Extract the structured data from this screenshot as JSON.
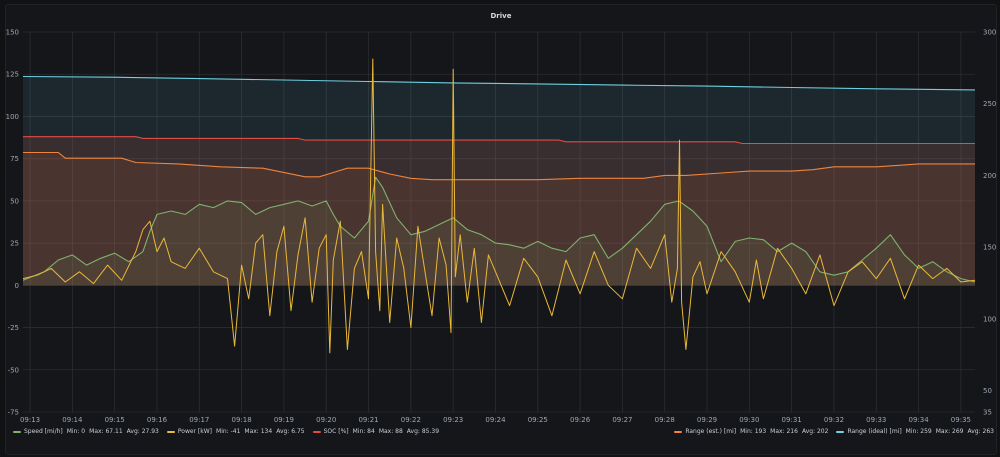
{
  "panel": {
    "title": "Drive"
  },
  "chart_data": {
    "type": "line",
    "title": "Drive",
    "x_ticks": [
      "09:13",
      "09:14",
      "09:15",
      "09:16",
      "09:17",
      "09:18",
      "09:19",
      "09:20",
      "09:21",
      "09:22",
      "09:23",
      "09:24",
      "09:25",
      "09:26",
      "09:27",
      "09:28",
      "09:29",
      "09:30",
      "09:31",
      "09:32",
      "09:33",
      "09:34",
      "09:35"
    ],
    "x_range": [
      "09:12:50",
      "09:35:20"
    ],
    "y_left": {
      "range": [
        -75,
        150
      ],
      "ticks": [
        "150",
        "125",
        "100",
        "75",
        "50",
        "25",
        "0",
        "-25",
        "-50",
        "-75"
      ]
    },
    "y_right": {
      "range": [
        35,
        300
      ],
      "ticks": [
        "300",
        "250",
        "200",
        "150",
        "100",
        "50",
        "35"
      ]
    },
    "grid": true,
    "legend_position": "bottom",
    "series": [
      {
        "name": "Speed [mi/h]",
        "axis": "left",
        "color": "#7eb26d",
        "fill": true,
        "stats": {
          "min": "Min: 0",
          "max": "Max: 67.11",
          "avg": "Avg: 27.93"
        },
        "x": [
          "09:12:50",
          "09:13:20",
          "09:13:40",
          "09:14:00",
          "09:14:20",
          "09:14:40",
          "09:15:00",
          "09:15:20",
          "09:15:40",
          "09:15:50",
          "09:16:00",
          "09:16:20",
          "09:16:40",
          "09:17:00",
          "09:17:20",
          "09:17:40",
          "09:18:00",
          "09:18:20",
          "09:18:40",
          "09:19:00",
          "09:19:20",
          "09:19:40",
          "09:20:00",
          "09:20:10",
          "09:20:20",
          "09:20:40",
          "09:21:00",
          "09:21:10",
          "09:21:20",
          "09:21:40",
          "09:22:00",
          "09:22:20",
          "09:22:40",
          "09:23:00",
          "09:23:20",
          "09:23:40",
          "09:24:00",
          "09:24:20",
          "09:24:40",
          "09:25:00",
          "09:25:20",
          "09:25:40",
          "09:26:00",
          "09:26:20",
          "09:26:40",
          "09:27:00",
          "09:27:20",
          "09:27:40",
          "09:28:00",
          "09:28:20",
          "09:28:40",
          "09:29:00",
          "09:29:20",
          "09:29:40",
          "09:30:00",
          "09:30:20",
          "09:30:40",
          "09:31:00",
          "09:31:20",
          "09:31:40",
          "09:32:00",
          "09:32:20",
          "09:32:40",
          "09:33:00",
          "09:33:20",
          "09:33:40",
          "09:34:00",
          "09:34:20",
          "09:34:40",
          "09:35:00",
          "09:35:20"
        ],
        "y": [
          3,
          8,
          15,
          18,
          12,
          16,
          19,
          14,
          20,
          32,
          42,
          44,
          42,
          48,
          46,
          50,
          49,
          42,
          46,
          48,
          50,
          47,
          50,
          42,
          35,
          28,
          38,
          64,
          58,
          40,
          30,
          32,
          36,
          40,
          33,
          30,
          25,
          24,
          22,
          26,
          22,
          20,
          28,
          30,
          16,
          22,
          30,
          38,
          48,
          50,
          44,
          35,
          14,
          26,
          28,
          27,
          20,
          25,
          20,
          8,
          6,
          8,
          15,
          22,
          30,
          18,
          10,
          14,
          8,
          4,
          2
        ]
      },
      {
        "name": "Power [kW]",
        "axis": "left",
        "color": "#eab839",
        "fill": false,
        "stats": {
          "min": "Min: -41",
          "max": "Max: 134",
          "avg": "Avg: 6.75"
        },
        "x": [
          "09:12:50",
          "09:13:10",
          "09:13:30",
          "09:13:50",
          "09:14:10",
          "09:14:30",
          "09:14:50",
          "09:15:10",
          "09:15:30",
          "09:15:40",
          "09:15:50",
          "09:16:00",
          "09:16:10",
          "09:16:20",
          "09:16:40",
          "09:17:00",
          "09:17:20",
          "09:17:40",
          "09:17:50",
          "09:18:00",
          "09:18:10",
          "09:18:20",
          "09:18:30",
          "09:18:40",
          "09:18:50",
          "09:19:00",
          "09:19:10",
          "09:19:20",
          "09:19:30",
          "09:19:40",
          "09:19:50",
          "09:20:00",
          "09:20:05",
          "09:20:10",
          "09:20:20",
          "09:20:30",
          "09:20:40",
          "09:20:50",
          "09:21:00",
          "09:21:06",
          "09:21:10",
          "09:21:16",
          "09:21:20",
          "09:21:30",
          "09:21:40",
          "09:21:50",
          "09:22:00",
          "09:22:10",
          "09:22:20",
          "09:22:30",
          "09:22:40",
          "09:22:50",
          "09:22:57",
          "09:23:00",
          "09:23:03",
          "09:23:10",
          "09:23:20",
          "09:23:30",
          "09:23:40",
          "09:23:50",
          "09:24:00",
          "09:24:20",
          "09:24:40",
          "09:25:00",
          "09:25:20",
          "09:25:40",
          "09:26:00",
          "09:26:20",
          "09:26:40",
          "09:27:00",
          "09:27:20",
          "09:27:40",
          "09:28:00",
          "09:28:10",
          "09:28:18",
          "09:28:21",
          "09:28:24",
          "09:28:30",
          "09:28:40",
          "09:28:50",
          "09:29:00",
          "09:29:20",
          "09:29:40",
          "09:30:00",
          "09:30:10",
          "09:30:20",
          "09:30:40",
          "09:31:00",
          "09:31:20",
          "09:31:40",
          "09:32:00",
          "09:32:20",
          "09:32:40",
          "09:33:00",
          "09:33:20",
          "09:33:40",
          "09:34:00",
          "09:34:20",
          "09:34:40",
          "09:35:00",
          "09:35:20"
        ],
        "y": [
          4,
          6,
          10,
          2,
          8,
          1,
          12,
          3,
          20,
          33,
          38,
          20,
          28,
          14,
          10,
          22,
          8,
          4,
          -36,
          12,
          -8,
          25,
          30,
          -18,
          20,
          35,
          -15,
          18,
          40,
          -10,
          22,
          30,
          -40,
          15,
          38,
          -38,
          10,
          20,
          -8,
          134,
          20,
          -15,
          48,
          -22,
          28,
          10,
          -25,
          35,
          8,
          -18,
          28,
          12,
          -28,
          128,
          5,
          30,
          -10,
          22,
          -22,
          18,
          8,
          -12,
          16,
          5,
          -18,
          15,
          -5,
          20,
          0,
          -8,
          22,
          10,
          30,
          -10,
          10,
          86,
          -10,
          -38,
          5,
          14,
          -5,
          20,
          8,
          -10,
          15,
          -8,
          22,
          10,
          -5,
          18,
          -12,
          8,
          14,
          4,
          16,
          -8,
          12,
          4,
          10,
          2,
          3
        ]
      },
      {
        "name": "SOC [%]",
        "axis": "left",
        "color": "#e24d42",
        "fill": true,
        "stats": {
          "min": "Min: 84",
          "max": "Max: 88",
          "avg": "Avg: 85.39"
        },
        "x": [
          "09:12:50",
          "09:15:30",
          "09:15:40",
          "09:19:20",
          "09:19:30",
          "09:25:30",
          "09:25:40",
          "09:29:40",
          "09:29:50",
          "09:35:20"
        ],
        "y": [
          88,
          88,
          87,
          87,
          86,
          86,
          85,
          85,
          84,
          84
        ]
      },
      {
        "name": "Range (est.) [mi]",
        "axis": "right",
        "color": "#ef843c",
        "fill": true,
        "stats": {
          "min": "Min: 193",
          "max": "Max: 216",
          "avg": "Avg: 202"
        },
        "x": [
          "09:12:50",
          "09:13:40",
          "09:13:50",
          "09:15:10",
          "09:15:30",
          "09:16:30",
          "09:17:30",
          "09:18:30",
          "09:19:30",
          "09:19:50",
          "09:20:10",
          "09:20:30",
          "09:21:00",
          "09:21:30",
          "09:22:00",
          "09:22:30",
          "09:23:30",
          "09:24:30",
          "09:25:00",
          "09:26:00",
          "09:26:30",
          "09:27:30",
          "09:28:00",
          "09:28:30",
          "09:29:30",
          "09:30:00",
          "09:31:00",
          "09:31:30",
          "09:32:00",
          "09:33:00",
          "09:33:30",
          "09:34:00",
          "09:35:20"
        ],
        "y": [
          216,
          216,
          212,
          212,
          209,
          208,
          206,
          205,
          199,
          199,
          202,
          205,
          205,
          201,
          198,
          197,
          197,
          197,
          197,
          198,
          198,
          198,
          200,
          200,
          202,
          203,
          203,
          204,
          206,
          206,
          207,
          208,
          208
        ]
      },
      {
        "name": "Range (ideal) [mi]",
        "axis": "right",
        "color": "#6ed0e0",
        "fill": true,
        "stats": {
          "min": "Min: 259",
          "max": "Max: 269",
          "avg": "Avg: 263"
        },
        "x": [
          "09:12:50",
          "09:15:00",
          "09:17:00",
          "09:19:00",
          "09:21:00",
          "09:23:00",
          "09:25:00",
          "09:27:00",
          "09:29:00",
          "09:31:00",
          "09:33:00",
          "09:35:20"
        ],
        "y": [
          269,
          268.5,
          267.5,
          266.5,
          265.5,
          264.5,
          263.8,
          263,
          262.3,
          261.3,
          260.4,
          259.6
        ]
      }
    ]
  }
}
